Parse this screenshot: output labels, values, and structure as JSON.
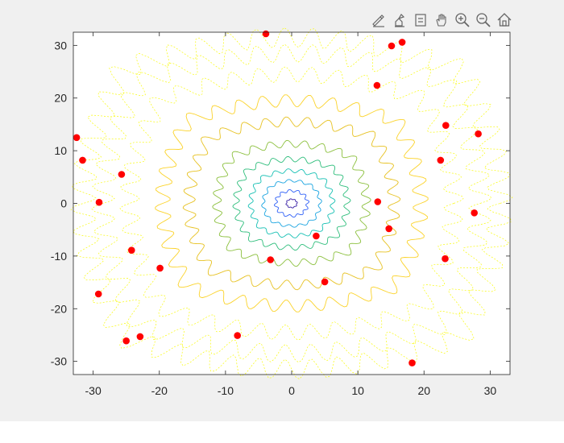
{
  "toolbar": {
    "buttons": [
      {
        "name": "brush-data-button",
        "icon": "brush-pen-icon"
      },
      {
        "name": "data-cursor-button",
        "icon": "data-tips-icon"
      },
      {
        "name": "link-button",
        "icon": "insert-legend-icon"
      },
      {
        "name": "pan-button",
        "icon": "hand-pan-icon"
      },
      {
        "name": "zoom-in-button",
        "icon": "zoom-in-icon"
      },
      {
        "name": "zoom-out-button",
        "icon": "zoom-out-icon"
      },
      {
        "name": "home-button",
        "icon": "home-icon"
      }
    ]
  },
  "chart_data": {
    "type": "scatter",
    "title": "",
    "xlabel": "",
    "ylabel": "",
    "xlim": [
      -33,
      33
    ],
    "ylim": [
      -32.5,
      32.5
    ],
    "xticks": [
      -30,
      -20,
      -10,
      0,
      10,
      20,
      30
    ],
    "yticks": [
      -30,
      -20,
      -10,
      0,
      10,
      20,
      30
    ],
    "grid": false,
    "colors": {
      "points": "#ff0000",
      "contour_levels": [
        "#3e26a8",
        "#2f60f7",
        "#1aa4e0",
        "#17c0b4",
        "#2fbe7c",
        "#8cc03e",
        "#e7c223",
        "#fbd32b",
        "#f9fb0e"
      ],
      "axes": "#262626",
      "figure_background": "#f0f0f0"
    },
    "contour": {
      "center": [
        0,
        0
      ],
      "level_radii": [
        0.8,
        2.4,
        4.3,
        6.2,
        8.4,
        11.3,
        15.5,
        19.5,
        24.5,
        28.5,
        31.5
      ]
    },
    "series": [
      {
        "x": [
          -32.5,
          -31.6,
          -29.1,
          -29.2,
          -25.7,
          -24.2,
          -19.9,
          -25,
          -22.9,
          -8.2,
          -3.9,
          -3.2,
          3.7,
          5,
          13,
          14.7,
          15.1,
          16.7,
          12.9,
          18.2,
          22.5,
          23.3,
          23.2,
          27.6,
          28.2
        ],
        "y": [
          12.5,
          8.2,
          0.2,
          -17.2,
          5.5,
          -8.9,
          -12.3,
          -26.1,
          -25.3,
          -25.1,
          32.2,
          -10.7,
          -6.2,
          -14.9,
          0.3,
          -4.8,
          29.9,
          30.6,
          22.4,
          -30.3,
          8.2,
          14.8,
          -10.5,
          -1.8,
          13.2
        ]
      }
    ]
  }
}
